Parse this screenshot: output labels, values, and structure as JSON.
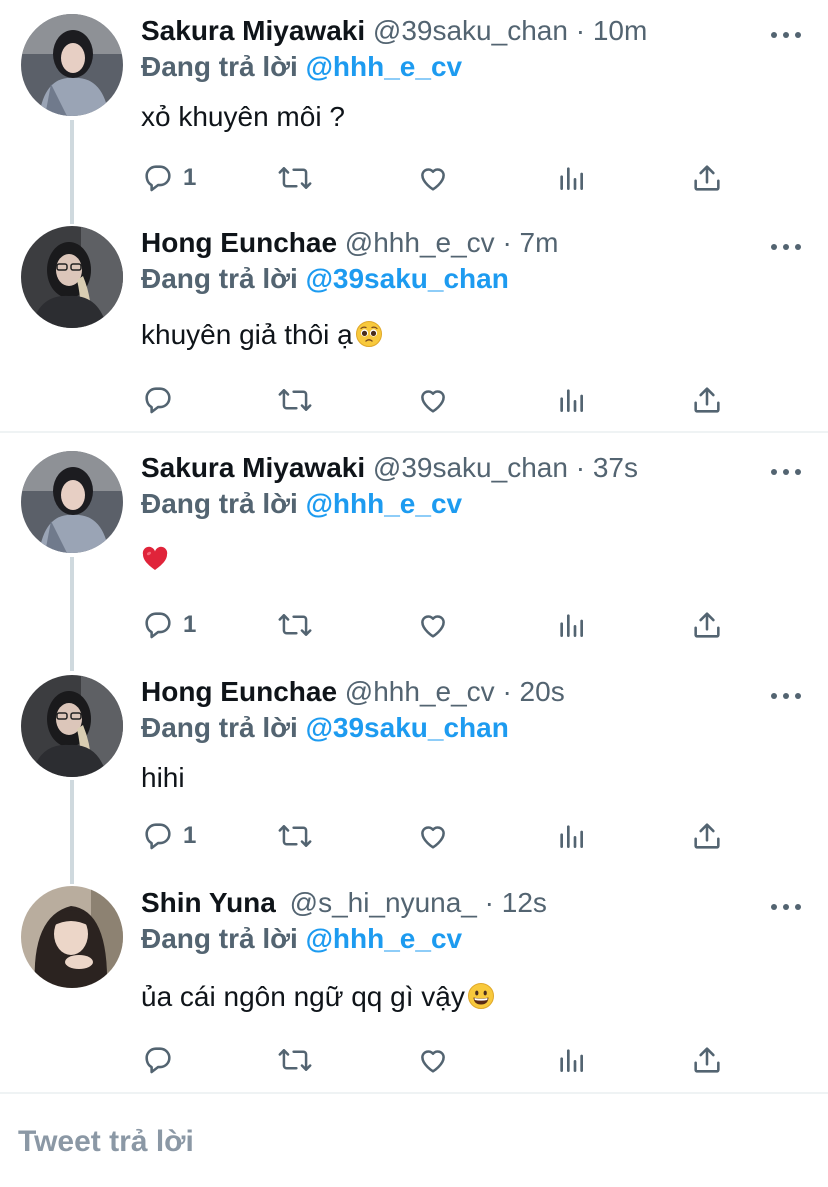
{
  "tweets": [
    {
      "name": "Sakura Miyawaki",
      "handle": "@39saku_chan",
      "dot": "·",
      "time": "10m",
      "reply_prefix": "Đang trả lời",
      "reply_to": "@hhh_e_cv",
      "text": "xỏ khuyên môi ?",
      "reply_count": "1"
    },
    {
      "name": "Hong Eunchae",
      "handle": "@hhh_e_cv",
      "dot": "·",
      "time": "7m",
      "reply_prefix": "Đang trả lời",
      "reply_to": "@39saku_chan",
      "text": "khuyên giả thôi ạ",
      "emoji": "pleading-face",
      "reply_count": ""
    },
    {
      "name": "Sakura Miyawaki",
      "handle": "@39saku_chan",
      "dot": "·",
      "time": "37s",
      "reply_prefix": "Đang trả lời",
      "reply_to": "@hhh_e_cv",
      "text": "",
      "emoji": "red-heart",
      "reply_count": "1"
    },
    {
      "name": "Hong Eunchae",
      "handle": "@hhh_e_cv",
      "dot": "·",
      "time": "20s",
      "reply_prefix": "Đang trả lời",
      "reply_to": "@39saku_chan",
      "text": "hihi",
      "reply_count": "1"
    },
    {
      "name": "Shin Yuna",
      "handle": "@s_hi_nyuna_",
      "dot": "·",
      "time": "12s",
      "reply_prefix": "Đang trả lời",
      "reply_to": "@hhh_e_cv",
      "text": "ủa cái ngôn ngữ qq gì vậy",
      "emoji": "grinning-face",
      "reply_count": ""
    }
  ],
  "compose": {
    "placeholder": "Tweet trả lời"
  },
  "colors": {
    "mention": "#1d9bf0",
    "secondary_text": "#536471",
    "icon": "#536471",
    "thread_line": "#cfd9de",
    "divider": "#eff3f4"
  },
  "icons": [
    "reply-icon",
    "retweet-icon",
    "like-icon",
    "analytics-icon",
    "share-icon",
    "more-icon"
  ]
}
